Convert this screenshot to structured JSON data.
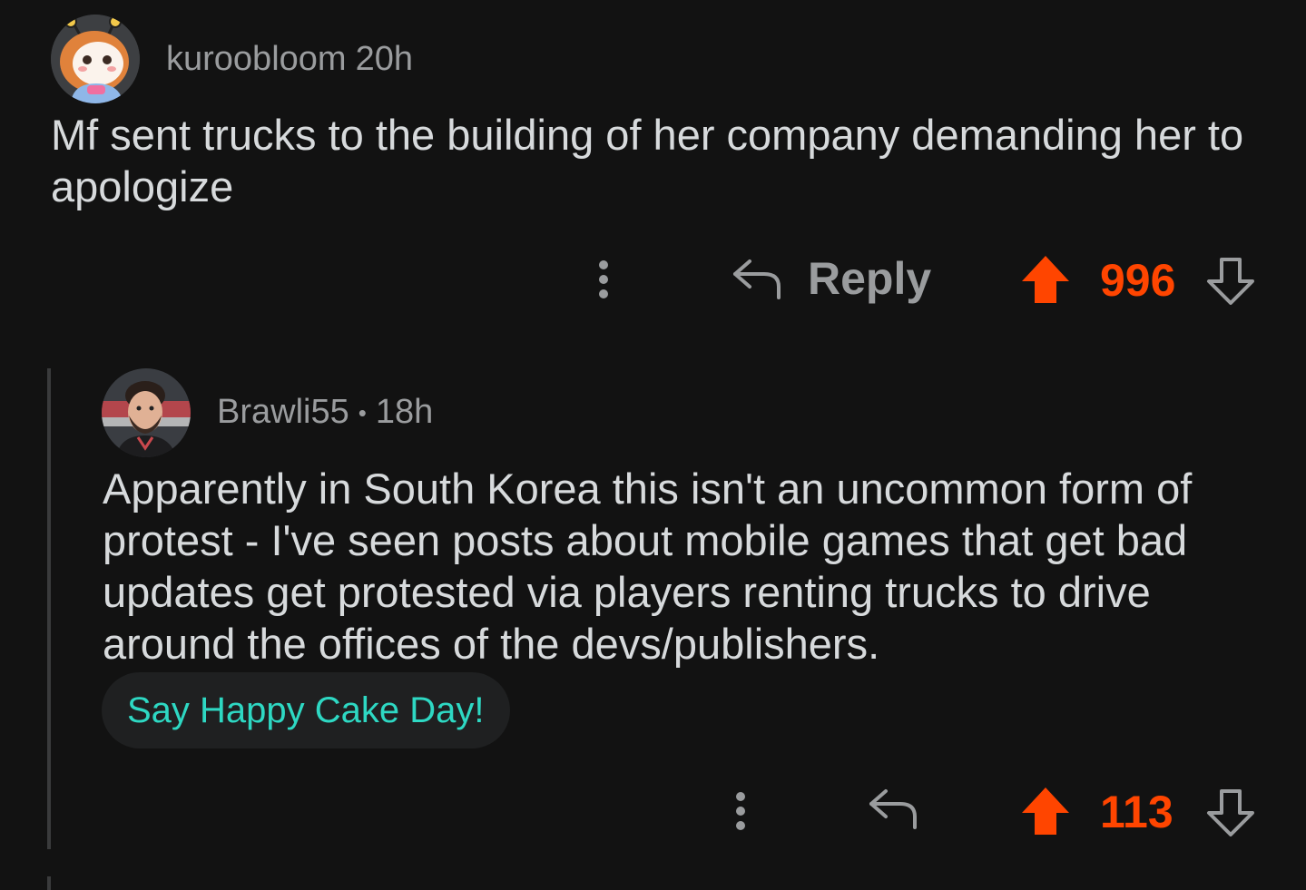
{
  "comments": [
    {
      "username": "kuroobloom",
      "time": "20h",
      "avatar_icon": "anime-girl-avatar",
      "body": "Mf sent trucks to the building of her company demanding her to apologize",
      "reply_label": "Reply",
      "votes": "996"
    },
    {
      "username": "Brawli55",
      "separator": "•",
      "time": "18h",
      "avatar_icon": "man-avatar",
      "body": "Apparently in South Korea this isn't an uncommon form of protest - I've seen posts about mobile games that get bad updates get protested via players renting trucks to drive around the offices of the devs/publishers.",
      "cake_day_button": "Say Happy Cake Day!",
      "votes": "113"
    }
  ],
  "colors": {
    "background": "#121212",
    "upvote_active": "#ff4500",
    "cake_day_text": "#2ed8c3",
    "meta_text": "#9a9c9e"
  },
  "icons": {
    "more": "more-vertical-icon",
    "reply": "reply-arrow-icon",
    "upvote": "upvote-arrow-filled-icon",
    "downvote": "downvote-arrow-outline-icon"
  }
}
